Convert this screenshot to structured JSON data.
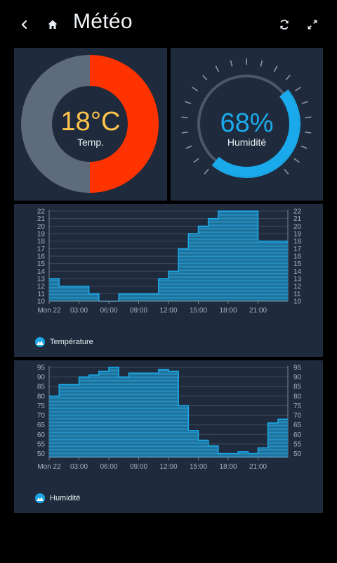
{
  "header": {
    "title": "Météo",
    "icons": [
      "back-arrow-icon",
      "home-icon",
      "refresh-icon",
      "fullscreen-icon"
    ]
  },
  "temperature_gauge": {
    "value": "18°C",
    "label": "Temp.",
    "fill_fraction": 0.5,
    "colors": {
      "fill": "#ff3300",
      "track": "#5d6b7a",
      "text": "#ffc44d"
    }
  },
  "humidity_gauge": {
    "value": "68%",
    "label": "Humidité",
    "fill_fraction": 0.68,
    "colors": {
      "fill": "#1aa9ea",
      "track": "#4b5868",
      "text": "#1aa9ea"
    }
  },
  "chart_data": [
    {
      "type": "area",
      "series": [
        {
          "name": "Température",
          "x": [
            "00:00",
            "01:00",
            "02:00",
            "03:00",
            "04:00",
            "05:00",
            "06:00",
            "07:00",
            "08:00",
            "09:00",
            "10:00",
            "11:00",
            "12:00",
            "13:00",
            "14:00",
            "15:00",
            "16:00",
            "17:00",
            "18:00",
            "19:00",
            "20:00",
            "21:00",
            "22:00",
            "23:00"
          ],
          "values": [
            13,
            12,
            12,
            12,
            11,
            10,
            10,
            11,
            11,
            11,
            11,
            13,
            14,
            17,
            19,
            20,
            21,
            22,
            22,
            22,
            22,
            18,
            18,
            18
          ]
        }
      ],
      "ylim": [
        10,
        22
      ],
      "yticks": [
        10,
        11,
        12,
        13,
        14,
        15,
        16,
        17,
        18,
        19,
        20,
        21,
        22
      ],
      "xtick_labels": [
        "Mon 22",
        "03:00",
        "06:00",
        "09:00",
        "12:00",
        "15:00",
        "18:00",
        "21:00"
      ],
      "legend": "bottom-left",
      "color": "#1aa9ea"
    },
    {
      "type": "area",
      "series": [
        {
          "name": "Humidité",
          "x": [
            "00:00",
            "01:00",
            "02:00",
            "03:00",
            "04:00",
            "05:00",
            "06:00",
            "07:00",
            "08:00",
            "09:00",
            "10:00",
            "11:00",
            "12:00",
            "13:00",
            "14:00",
            "15:00",
            "16:00",
            "17:00",
            "18:00",
            "19:00",
            "20:00",
            "21:00",
            "22:00",
            "23:00"
          ],
          "values": [
            80,
            86,
            86,
            90,
            91,
            93,
            95,
            90,
            92,
            92,
            92,
            94,
            93,
            75,
            62,
            57,
            54,
            50,
            50,
            51,
            50,
            53,
            66,
            68
          ]
        }
      ],
      "ylim": [
        48,
        95
      ],
      "yticks": [
        50,
        55,
        60,
        65,
        70,
        75,
        80,
        85,
        90,
        95
      ],
      "xtick_labels": [
        "Mon 22",
        "03:00",
        "06:00",
        "09:00",
        "12:00",
        "15:00",
        "18:00",
        "21:00"
      ],
      "legend": "bottom-left",
      "color": "#1aa9ea"
    }
  ]
}
